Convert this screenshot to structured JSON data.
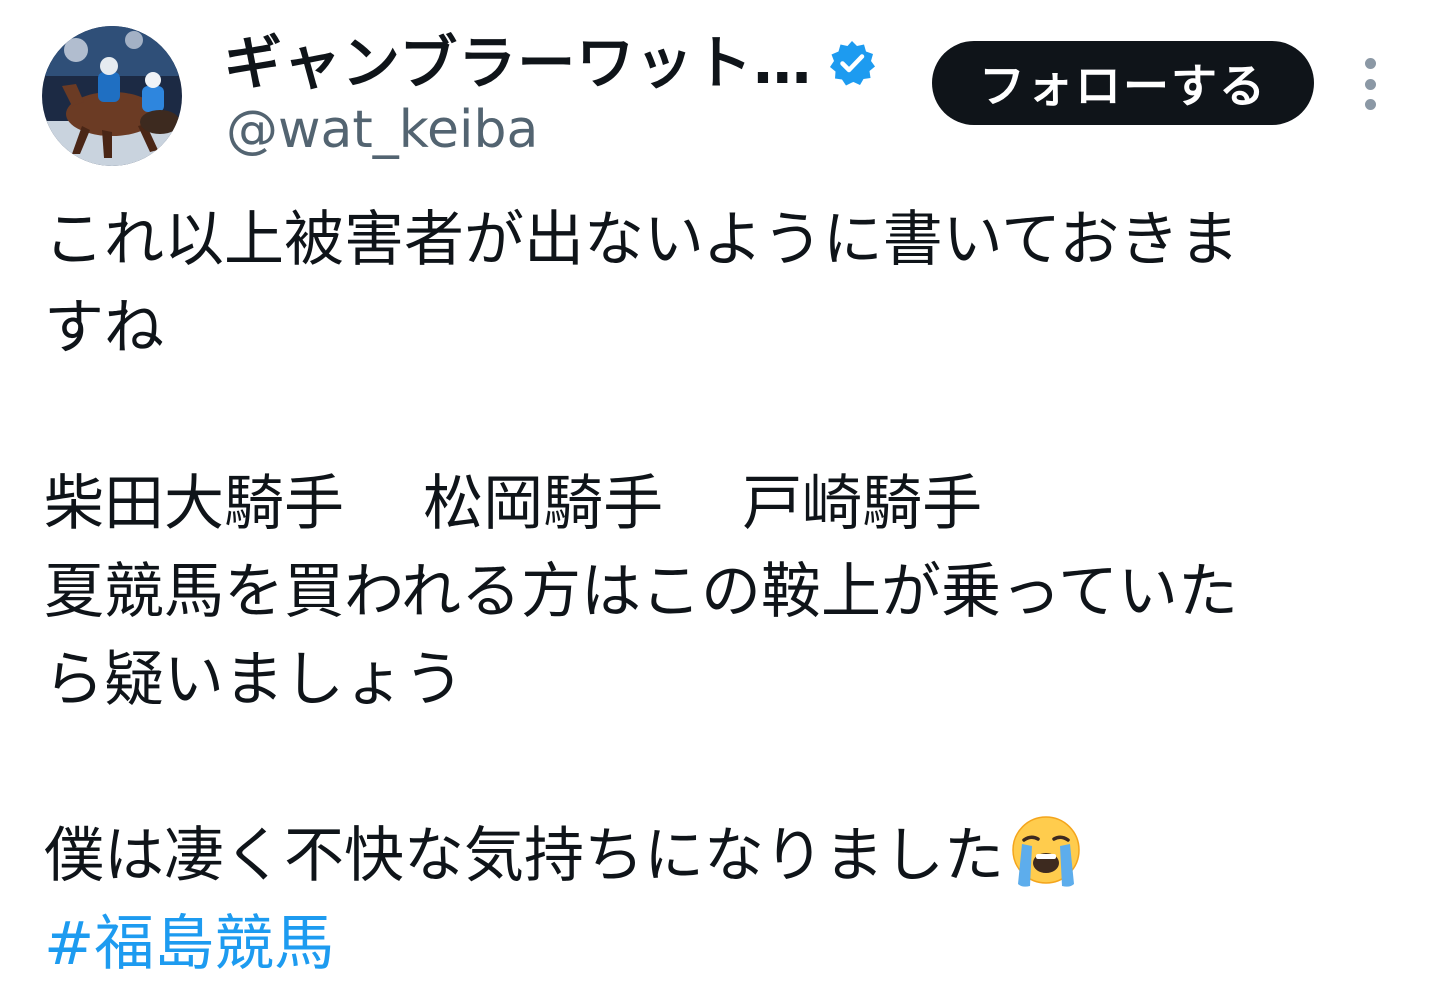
{
  "user": {
    "display_name": "ギャンブラーワット…",
    "handle": "@wat_keiba",
    "verified": true,
    "avatar": "horse-racing-avatar"
  },
  "actions": {
    "follow_label": "フォローする",
    "more_icon": "more-vertical-icon"
  },
  "tweet": {
    "lines": [
      "これ以上被害者が出ないように書いておきま",
      "すね",
      "柴田大騎手　 松岡騎手　 戸崎騎手",
      "夏競馬を買われる方はこの鞍上が乗っていた",
      "ら疑いましょう",
      "僕は凄く不快な気持ちになりました"
    ],
    "emoji": "loudly-crying-face-emoji",
    "hashtag": "#福島競馬"
  },
  "colors": {
    "text": "#0f1419",
    "secondary": "#536471",
    "link": "#1d9bf0",
    "button_bg": "#0f1419",
    "verified": "#1d9bf0"
  }
}
